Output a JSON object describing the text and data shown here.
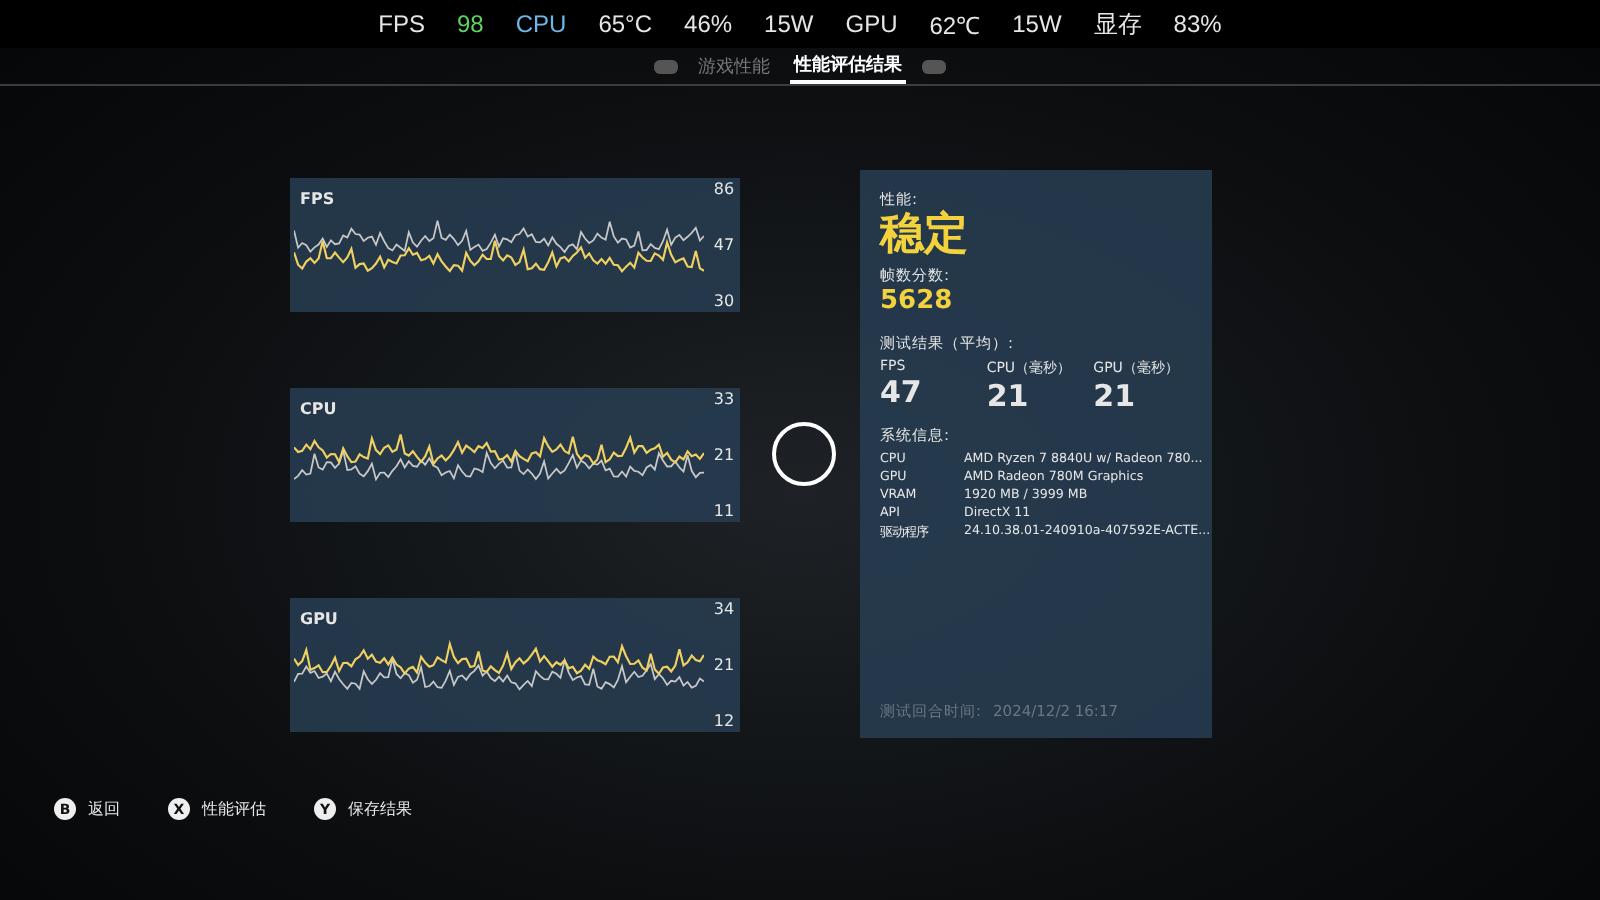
{
  "overlay_stats": [
    {
      "text": "FPS",
      "color": "#e6e6e6"
    },
    {
      "text": "98",
      "color": "#5fd35f"
    },
    {
      "text": "CPU",
      "color": "#6fb6e6"
    },
    {
      "text": "65°C",
      "color": "#e6e6e6"
    },
    {
      "text": "46%",
      "color": "#e6e6e6"
    },
    {
      "text": "15W",
      "color": "#e6e6e6"
    },
    {
      "text": "GPU",
      "color": "#e6e6e6"
    },
    {
      "text": "62℃",
      "color": "#e6e6e6"
    },
    {
      "text": "15W",
      "color": "#e6e6e6"
    },
    {
      "text": "显存",
      "color": "#e6e6e6"
    },
    {
      "text": "83%",
      "color": "#e6e6e6"
    }
  ],
  "tabs": [
    {
      "label": "游戏性能",
      "selected": false
    },
    {
      "label": "性能评估结果",
      "selected": true
    }
  ],
  "graphs": [
    {
      "title": "FPS",
      "max": "86",
      "avg": "47",
      "min": "30"
    },
    {
      "title": "CPU",
      "max": "33",
      "avg": "21",
      "min": "11"
    },
    {
      "title": "GPU",
      "max": "34",
      "avg": "21",
      "min": "12"
    }
  ],
  "result": {
    "performance_label": "性能:",
    "performance": "稳定",
    "score_label": "帧数分数:",
    "score": "5628",
    "averages_label": "测试结果（平均）:",
    "averages": [
      {
        "label": "FPS",
        "value": "47"
      },
      {
        "label": "CPU（毫秒）",
        "value": "21"
      },
      {
        "label": "GPU（毫秒）",
        "value": "21"
      }
    ],
    "system_label": "系统信息:",
    "system": [
      {
        "key": "CPU",
        "value": "AMD Ryzen 7 8840U w/ Radeon 780..."
      },
      {
        "key": "GPU",
        "value": "AMD Radeon 780M Graphics"
      },
      {
        "key": "VRAM",
        "value": "1920 MB / 3999 MB"
      },
      {
        "key": "API",
        "value": "DirectX 11"
      },
      {
        "key": "驱动程序",
        "value": "24.10.38.01-240910a-407592E-ACTE..."
      }
    ],
    "time_label": "测试回合时间:",
    "time": "2024/12/2 16:17"
  },
  "footer": [
    {
      "key": "B",
      "label": "返回"
    },
    {
      "key": "X",
      "label": "性能评估"
    },
    {
      "key": "Y",
      "label": "保存结果"
    }
  ]
}
